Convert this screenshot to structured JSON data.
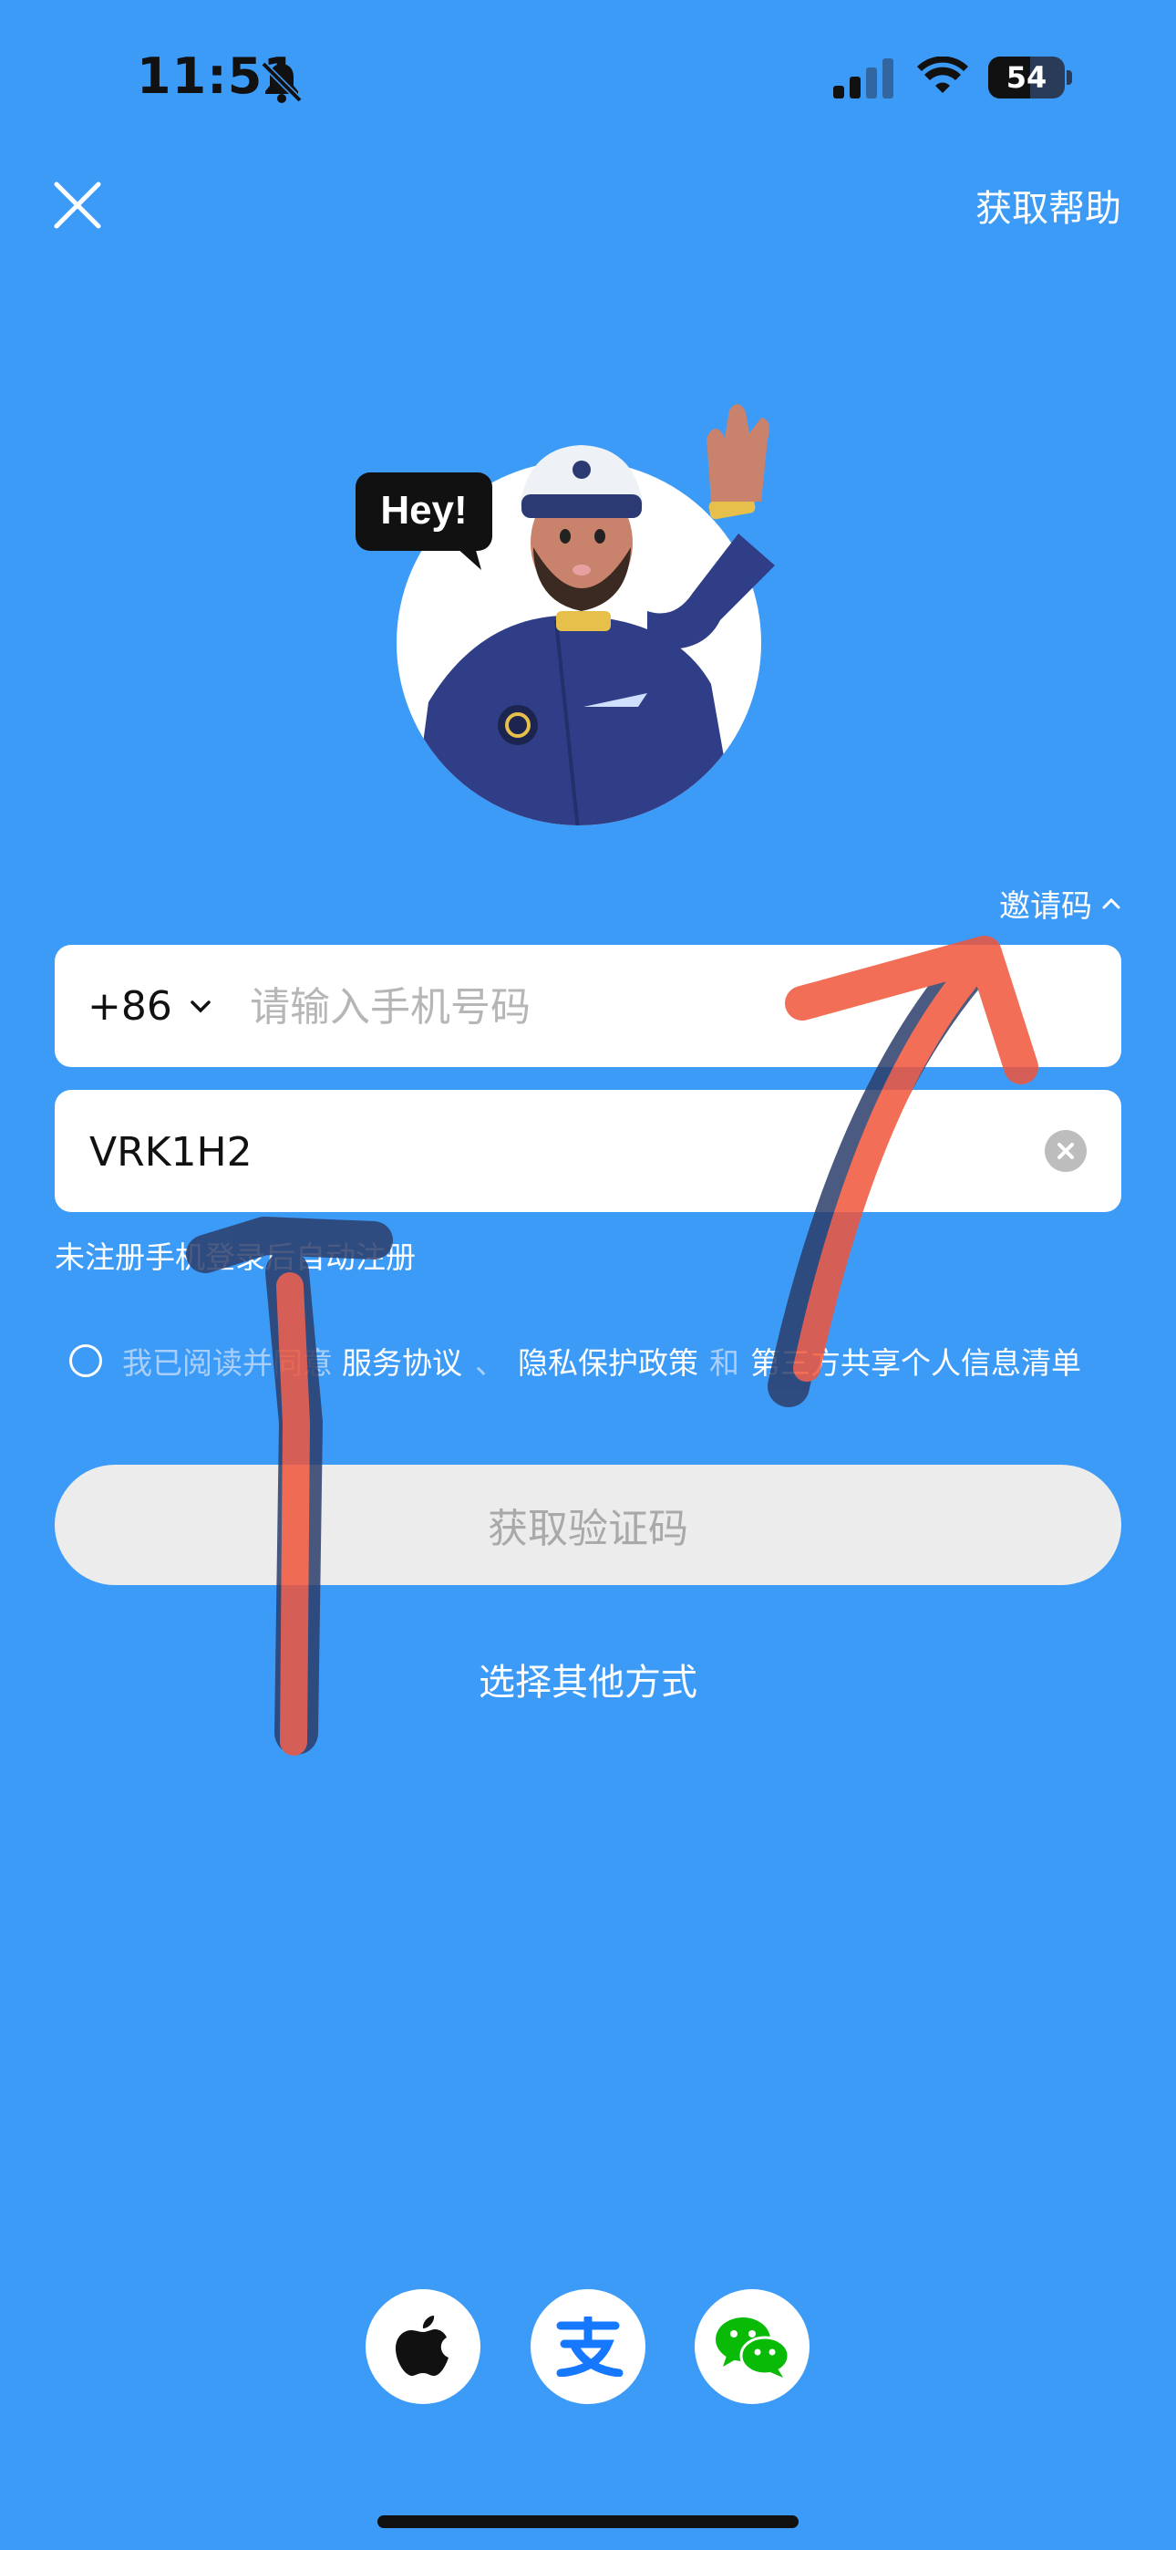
{
  "status_bar": {
    "time": "11:51",
    "battery": "54",
    "icons": [
      "bell-slash-icon",
      "cellular-signal-icon",
      "wifi-icon",
      "battery-icon"
    ]
  },
  "header": {
    "close_icon": "close-icon",
    "help_label": "获取帮助"
  },
  "hero": {
    "bubble_text": "Hey!"
  },
  "invite": {
    "label": "邀请码",
    "icon": "chevron-up-icon"
  },
  "phone_field": {
    "country_code": "+86",
    "placeholder": "请输入手机号码",
    "value": ""
  },
  "invite_field": {
    "value": "VRK1H2",
    "clear_icon": "clear-icon"
  },
  "hint": "未注册手机登录后自动注册",
  "agreement": {
    "prefix": "我已阅读并同意",
    "service_terms": "服务协议",
    "separator": "、",
    "privacy_policy": "隐私保护政策",
    "and": "和",
    "third_party": "第三方共享个人信息清单"
  },
  "primary_button": "获取验证码",
  "other_method": "选择其他方式",
  "social_logins": [
    {
      "name": "apple-icon"
    },
    {
      "name": "alipay-icon"
    },
    {
      "name": "wechat-icon"
    }
  ],
  "colors": {
    "background": "#3D9BF8",
    "annotation_red": "#F0553A",
    "annotation_dark": "#2C3E6B"
  }
}
